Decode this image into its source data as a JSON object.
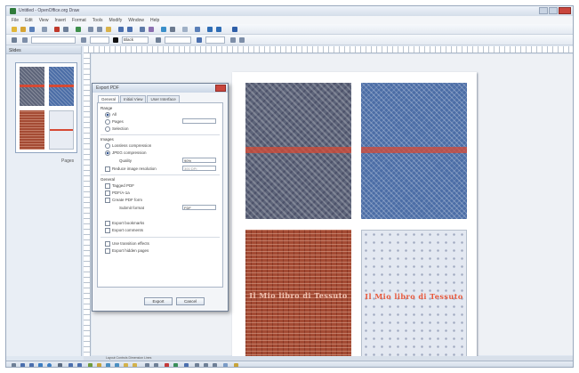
{
  "window": {
    "title": "Untitled - OpenOffice.org Draw"
  },
  "menu": [
    "File",
    "Edit",
    "View",
    "Insert",
    "Format",
    "Tools",
    "Modify",
    "Window",
    "Help"
  ],
  "toolbar": {
    "font_field": "",
    "color_field": "Black",
    "zoom_field": ""
  },
  "side_panel": {
    "title": "Slides",
    "thumbnail_label": "Pages"
  },
  "page": {
    "tiles": [
      {
        "text": ""
      },
      {
        "text": ""
      },
      {
        "text": "Il Mio libro di Tessuto"
      },
      {
        "text": "Il Mio libro di Tessuto"
      }
    ]
  },
  "dialog": {
    "title": "Export PDF",
    "tabs": [
      "General",
      "Initial View",
      "User Interface",
      "Links",
      "Security"
    ],
    "groups": {
      "range": "Range",
      "images": "Images",
      "general": "General"
    },
    "options": {
      "all": "All",
      "pages": "Pages",
      "selection": "Selection",
      "lossless": "Lossless compression",
      "jpeg": "JPEG compression",
      "quality_label": "Quality",
      "quality_value": "90%",
      "reduce": "Reduce image resolution",
      "reduce_value": "300 DPI",
      "tagged": "Tagged PDF",
      "pdfa": "PDF/A-1a",
      "create_form": "Create PDF form",
      "submit_label": "Submit format",
      "submit_value": "FDF",
      "export_bookmarks": "Export bookmarks",
      "export_comments": "Export comments",
      "transitions": "Use transition effects",
      "hidden_pages": "Export hidden pages"
    },
    "buttons": {
      "export": "Export",
      "cancel": "Cancel",
      "help": "Help"
    }
  },
  "status": {
    "sheet_tab": "Layout   Controls   Dimension Lines"
  },
  "colors": {
    "tile_blue_grey": "#5d6479",
    "tile_blue": "#4b6da6",
    "tile_brick": "#a44b34",
    "tile_light": "#e3e8f1",
    "stripe_red": "#d64a34"
  }
}
